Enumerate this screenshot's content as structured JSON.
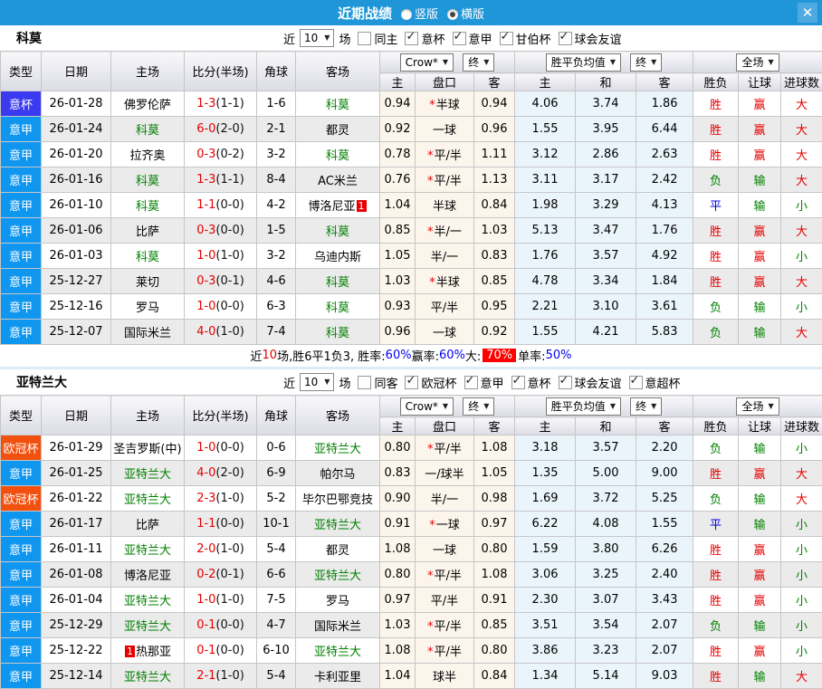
{
  "colors": {
    "titlebar": "#1e96d7",
    "type_badges": {
      "意杯": "#3a3af0",
      "意甲": "#0f97f0",
      "欧冠杯": "#f2500e"
    },
    "accent_red": "#e60000",
    "accent_green": "#008000",
    "accent_blue": "#0000e6"
  },
  "titlebar": {
    "title": "近期战绩",
    "options": [
      {
        "label": "竖版",
        "selected": false
      },
      {
        "label": "横版",
        "selected": true
      }
    ],
    "close_icon": "✕"
  },
  "table_header": {
    "type": "类型",
    "date": "日期",
    "home": "主场",
    "score": "比分(半场)",
    "corner": "角球",
    "away": "客场",
    "crown_select": "Crow*",
    "crown_stage": "终",
    "odds_home": "主",
    "odds_handicap": "盘口",
    "odds_away": "客",
    "euro_select": "胜平负均值",
    "euro_stage": "终",
    "euro_home": "主",
    "euro_draw": "和",
    "euro_away": "客",
    "scope_select": "全场",
    "result_wl": "胜负",
    "result_handicap": "让球",
    "result_goals": "进球数",
    "dropdown_arrow": "▼"
  },
  "sections": [
    {
      "team": "科莫",
      "filter": {
        "prefix": "近",
        "count": "10",
        "suffix": "场",
        "venue": {
          "label": "同主",
          "checked": false
        },
        "leagues": [
          {
            "label": "意杯",
            "checked": true
          },
          {
            "label": "意甲",
            "checked": true
          },
          {
            "label": "甘伯杯",
            "checked": true
          },
          {
            "label": "球会友谊",
            "checked": true
          }
        ]
      },
      "rows": [
        {
          "type": "意杯",
          "date": "26-01-28",
          "home": "佛罗伦萨",
          "home_badge": null,
          "ft": "1-3",
          "ht": "1-1",
          "corner": "1-6",
          "away": "科莫",
          "away_badge": null,
          "crown": [
            "0.94",
            "半球",
            "0.94"
          ],
          "ast": true,
          "euro": [
            "4.06",
            "3.74",
            "1.86"
          ],
          "results": [
            "胜",
            "赢",
            "大"
          ]
        },
        {
          "type": "意甲",
          "date": "26-01-24",
          "home": "科莫",
          "home_badge": null,
          "ft": "6-0",
          "ht": "2-0",
          "corner": "2-1",
          "away": "都灵",
          "away_badge": null,
          "crown": [
            "0.92",
            "一球",
            "0.96"
          ],
          "ast": false,
          "euro": [
            "1.55",
            "3.95",
            "6.44"
          ],
          "results": [
            "胜",
            "赢",
            "大"
          ]
        },
        {
          "type": "意甲",
          "date": "26-01-20",
          "home": "拉齐奥",
          "home_badge": null,
          "ft": "0-3",
          "ht": "0-2",
          "corner": "3-2",
          "away": "科莫",
          "away_badge": null,
          "crown": [
            "0.78",
            "平/半",
            "1.11"
          ],
          "ast": true,
          "euro": [
            "3.12",
            "2.86",
            "2.63"
          ],
          "results": [
            "胜",
            "赢",
            "大"
          ]
        },
        {
          "type": "意甲",
          "date": "26-01-16",
          "home": "科莫",
          "home_badge": null,
          "ft": "1-3",
          "ht": "1-1",
          "corner": "8-4",
          "away": "AC米兰",
          "away_badge": null,
          "crown": [
            "0.76",
            "平/半",
            "1.13"
          ],
          "ast": true,
          "euro": [
            "3.11",
            "3.17",
            "2.42"
          ],
          "results": [
            "负",
            "输",
            "大"
          ]
        },
        {
          "type": "意甲",
          "date": "26-01-10",
          "home": "科莫",
          "home_badge": null,
          "ft": "1-1",
          "ht": "0-0",
          "corner": "4-2",
          "away": "博洛尼亚",
          "away_badge": {
            "text": "1",
            "pos": "after"
          },
          "crown": [
            "1.04",
            "半球",
            "0.84"
          ],
          "ast": false,
          "euro": [
            "1.98",
            "3.29",
            "4.13"
          ],
          "results": [
            "平",
            "输",
            "小"
          ]
        },
        {
          "type": "意甲",
          "date": "26-01-06",
          "home": "比萨",
          "home_badge": null,
          "ft": "0-3",
          "ht": "0-0",
          "corner": "1-5",
          "away": "科莫",
          "away_badge": null,
          "crown": [
            "0.85",
            "半/一",
            "1.03"
          ],
          "ast": true,
          "euro": [
            "5.13",
            "3.47",
            "1.76"
          ],
          "results": [
            "胜",
            "赢",
            "大"
          ]
        },
        {
          "type": "意甲",
          "date": "26-01-03",
          "home": "科莫",
          "home_badge": null,
          "ft": "1-0",
          "ht": "1-0",
          "corner": "3-2",
          "away": "乌迪内斯",
          "away_badge": null,
          "crown": [
            "1.05",
            "半/一",
            "0.83"
          ],
          "ast": false,
          "euro": [
            "1.76",
            "3.57",
            "4.92"
          ],
          "results": [
            "胜",
            "赢",
            "小"
          ]
        },
        {
          "type": "意甲",
          "date": "25-12-27",
          "home": "莱切",
          "home_badge": null,
          "ft": "0-3",
          "ht": "0-1",
          "corner": "4-6",
          "away": "科莫",
          "away_badge": null,
          "crown": [
            "1.03",
            "半球",
            "0.85"
          ],
          "ast": true,
          "euro": [
            "4.78",
            "3.34",
            "1.84"
          ],
          "results": [
            "胜",
            "赢",
            "大"
          ]
        },
        {
          "type": "意甲",
          "date": "25-12-16",
          "home": "罗马",
          "home_badge": null,
          "ft": "1-0",
          "ht": "0-0",
          "corner": "6-3",
          "away": "科莫",
          "away_badge": null,
          "crown": [
            "0.93",
            "平/半",
            "0.95"
          ],
          "ast": false,
          "euro": [
            "2.21",
            "3.10",
            "3.61"
          ],
          "results": [
            "负",
            "输",
            "小"
          ]
        },
        {
          "type": "意甲",
          "date": "25-12-07",
          "home": "国际米兰",
          "home_badge": null,
          "ft": "4-0",
          "ht": "1-0",
          "corner": "7-4",
          "away": "科莫",
          "away_badge": null,
          "crown": [
            "0.96",
            "一球",
            "0.92"
          ],
          "ast": false,
          "euro": [
            "1.55",
            "4.21",
            "5.83"
          ],
          "results": [
            "负",
            "输",
            "大"
          ]
        }
      ],
      "summary": [
        {
          "text": "近",
          "style": "plain"
        },
        {
          "text": "10",
          "style": "red"
        },
        {
          "text": "场,胜6平1负3, 胜率:",
          "style": "plain"
        },
        {
          "text": "60%",
          "style": "blue"
        },
        {
          "text": " 赢率:",
          "style": "plain"
        },
        {
          "text": "60%",
          "style": "blue"
        },
        {
          "text": " 大:",
          "style": "plain"
        },
        {
          "text": "70%",
          "style": "highlight"
        },
        {
          "text": " 单率:",
          "style": "plain"
        },
        {
          "text": "50%",
          "style": "blue"
        }
      ]
    },
    {
      "team": "亚特兰大",
      "filter": {
        "prefix": "近",
        "count": "10",
        "suffix": "场",
        "venue": {
          "label": "同客",
          "checked": false
        },
        "leagues": [
          {
            "label": "欧冠杯",
            "checked": true
          },
          {
            "label": "意甲",
            "checked": true
          },
          {
            "label": "意杯",
            "checked": true
          },
          {
            "label": "球会友谊",
            "checked": true
          },
          {
            "label": "意超杯",
            "checked": true
          }
        ]
      },
      "rows": [
        {
          "type": "欧冠杯",
          "date": "26-01-29",
          "home": "圣吉罗斯(中)",
          "home_badge": null,
          "ft": "1-0",
          "ht": "0-0",
          "corner": "0-6",
          "away": "亚特兰大",
          "away_badge": null,
          "crown": [
            "0.80",
            "平/半",
            "1.08"
          ],
          "ast": true,
          "euro": [
            "3.18",
            "3.57",
            "2.20"
          ],
          "results": [
            "负",
            "输",
            "小"
          ]
        },
        {
          "type": "意甲",
          "date": "26-01-25",
          "home": "亚特兰大",
          "home_badge": null,
          "ft": "4-0",
          "ht": "2-0",
          "corner": "6-9",
          "away": "帕尔马",
          "away_badge": null,
          "crown": [
            "0.83",
            "一/球半",
            "1.05"
          ],
          "ast": false,
          "euro": [
            "1.35",
            "5.00",
            "9.00"
          ],
          "results": [
            "胜",
            "赢",
            "大"
          ]
        },
        {
          "type": "欧冠杯",
          "date": "26-01-22",
          "home": "亚特兰大",
          "home_badge": null,
          "ft": "2-3",
          "ht": "1-0",
          "corner": "5-2",
          "away": "毕尔巴鄂竞技",
          "away_badge": null,
          "crown": [
            "0.90",
            "半/一",
            "0.98"
          ],
          "ast": false,
          "euro": [
            "1.69",
            "3.72",
            "5.25"
          ],
          "results": [
            "负",
            "输",
            "大"
          ]
        },
        {
          "type": "意甲",
          "date": "26-01-17",
          "home": "比萨",
          "home_badge": null,
          "ft": "1-1",
          "ht": "0-0",
          "corner": "10-1",
          "away": "亚特兰大",
          "away_badge": null,
          "crown": [
            "0.91",
            "一球",
            "0.97"
          ],
          "ast": true,
          "euro": [
            "6.22",
            "4.08",
            "1.55"
          ],
          "results": [
            "平",
            "输",
            "小"
          ]
        },
        {
          "type": "意甲",
          "date": "26-01-11",
          "home": "亚特兰大",
          "home_badge": null,
          "ft": "2-0",
          "ht": "1-0",
          "corner": "5-4",
          "away": "都灵",
          "away_badge": null,
          "crown": [
            "1.08",
            "一球",
            "0.80"
          ],
          "ast": false,
          "euro": [
            "1.59",
            "3.80",
            "6.26"
          ],
          "results": [
            "胜",
            "赢",
            "小"
          ]
        },
        {
          "type": "意甲",
          "date": "26-01-08",
          "home": "博洛尼亚",
          "home_badge": null,
          "ft": "0-2",
          "ht": "0-1",
          "corner": "6-6",
          "away": "亚特兰大",
          "away_badge": null,
          "crown": [
            "0.80",
            "平/半",
            "1.08"
          ],
          "ast": true,
          "euro": [
            "3.06",
            "3.25",
            "2.40"
          ],
          "results": [
            "胜",
            "赢",
            "小"
          ]
        },
        {
          "type": "意甲",
          "date": "26-01-04",
          "home": "亚特兰大",
          "home_badge": null,
          "ft": "1-0",
          "ht": "1-0",
          "corner": "7-5",
          "away": "罗马",
          "away_badge": null,
          "crown": [
            "0.97",
            "平/半",
            "0.91"
          ],
          "ast": false,
          "euro": [
            "2.30",
            "3.07",
            "3.43"
          ],
          "results": [
            "胜",
            "赢",
            "小"
          ]
        },
        {
          "type": "意甲",
          "date": "25-12-29",
          "home": "亚特兰大",
          "home_badge": null,
          "ft": "0-1",
          "ht": "0-0",
          "corner": "4-7",
          "away": "国际米兰",
          "away_badge": null,
          "crown": [
            "1.03",
            "平/半",
            "0.85"
          ],
          "ast": true,
          "euro": [
            "3.51",
            "3.54",
            "2.07"
          ],
          "results": [
            "负",
            "输",
            "小"
          ]
        },
        {
          "type": "意甲",
          "date": "25-12-22",
          "home": "热那亚",
          "home_badge": {
            "text": "1",
            "pos": "before"
          },
          "ft": "0-1",
          "ht": "0-0",
          "corner": "6-10",
          "away": "亚特兰大",
          "away_badge": null,
          "crown": [
            "1.08",
            "平/半",
            "0.80"
          ],
          "ast": true,
          "euro": [
            "3.86",
            "3.23",
            "2.07"
          ],
          "results": [
            "胜",
            "赢",
            "小"
          ]
        },
        {
          "type": "意甲",
          "date": "25-12-14",
          "home": "亚特兰大",
          "home_badge": null,
          "ft": "2-1",
          "ht": "1-0",
          "corner": "5-4",
          "away": "卡利亚里",
          "away_badge": null,
          "crown": [
            "1.04",
            "球半",
            "0.84"
          ],
          "ast": false,
          "euro": [
            "1.34",
            "5.14",
            "9.03"
          ],
          "results": [
            "胜",
            "输",
            "大"
          ]
        }
      ],
      "summary": []
    }
  ]
}
